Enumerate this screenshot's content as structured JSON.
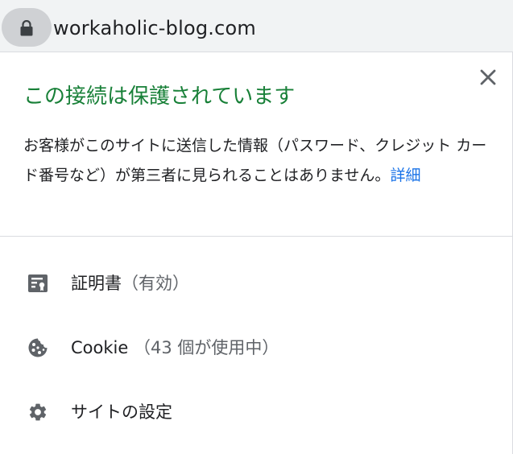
{
  "address_bar": {
    "url": "workaholic-blog.com",
    "lock_icon": "lock-icon"
  },
  "site_info_panel": {
    "title": "この接続は保護されています",
    "description": "お客様がこのサイトに送信した情報（パスワード、クレジット カード番号など）が第三者に見られることはありません。",
    "learn_more": "詳細",
    "close_icon": "close-icon",
    "title_color": "#188038",
    "link_color": "#1a73e8",
    "items": [
      {
        "icon": "certificate-icon",
        "label": "証明書",
        "detail": "（有効）"
      },
      {
        "icon": "cookie-icon",
        "label": "Cookie",
        "detail": "（43 個が使用中）"
      },
      {
        "icon": "settings-gear-icon",
        "label": "サイトの設定",
        "detail": ""
      }
    ]
  }
}
